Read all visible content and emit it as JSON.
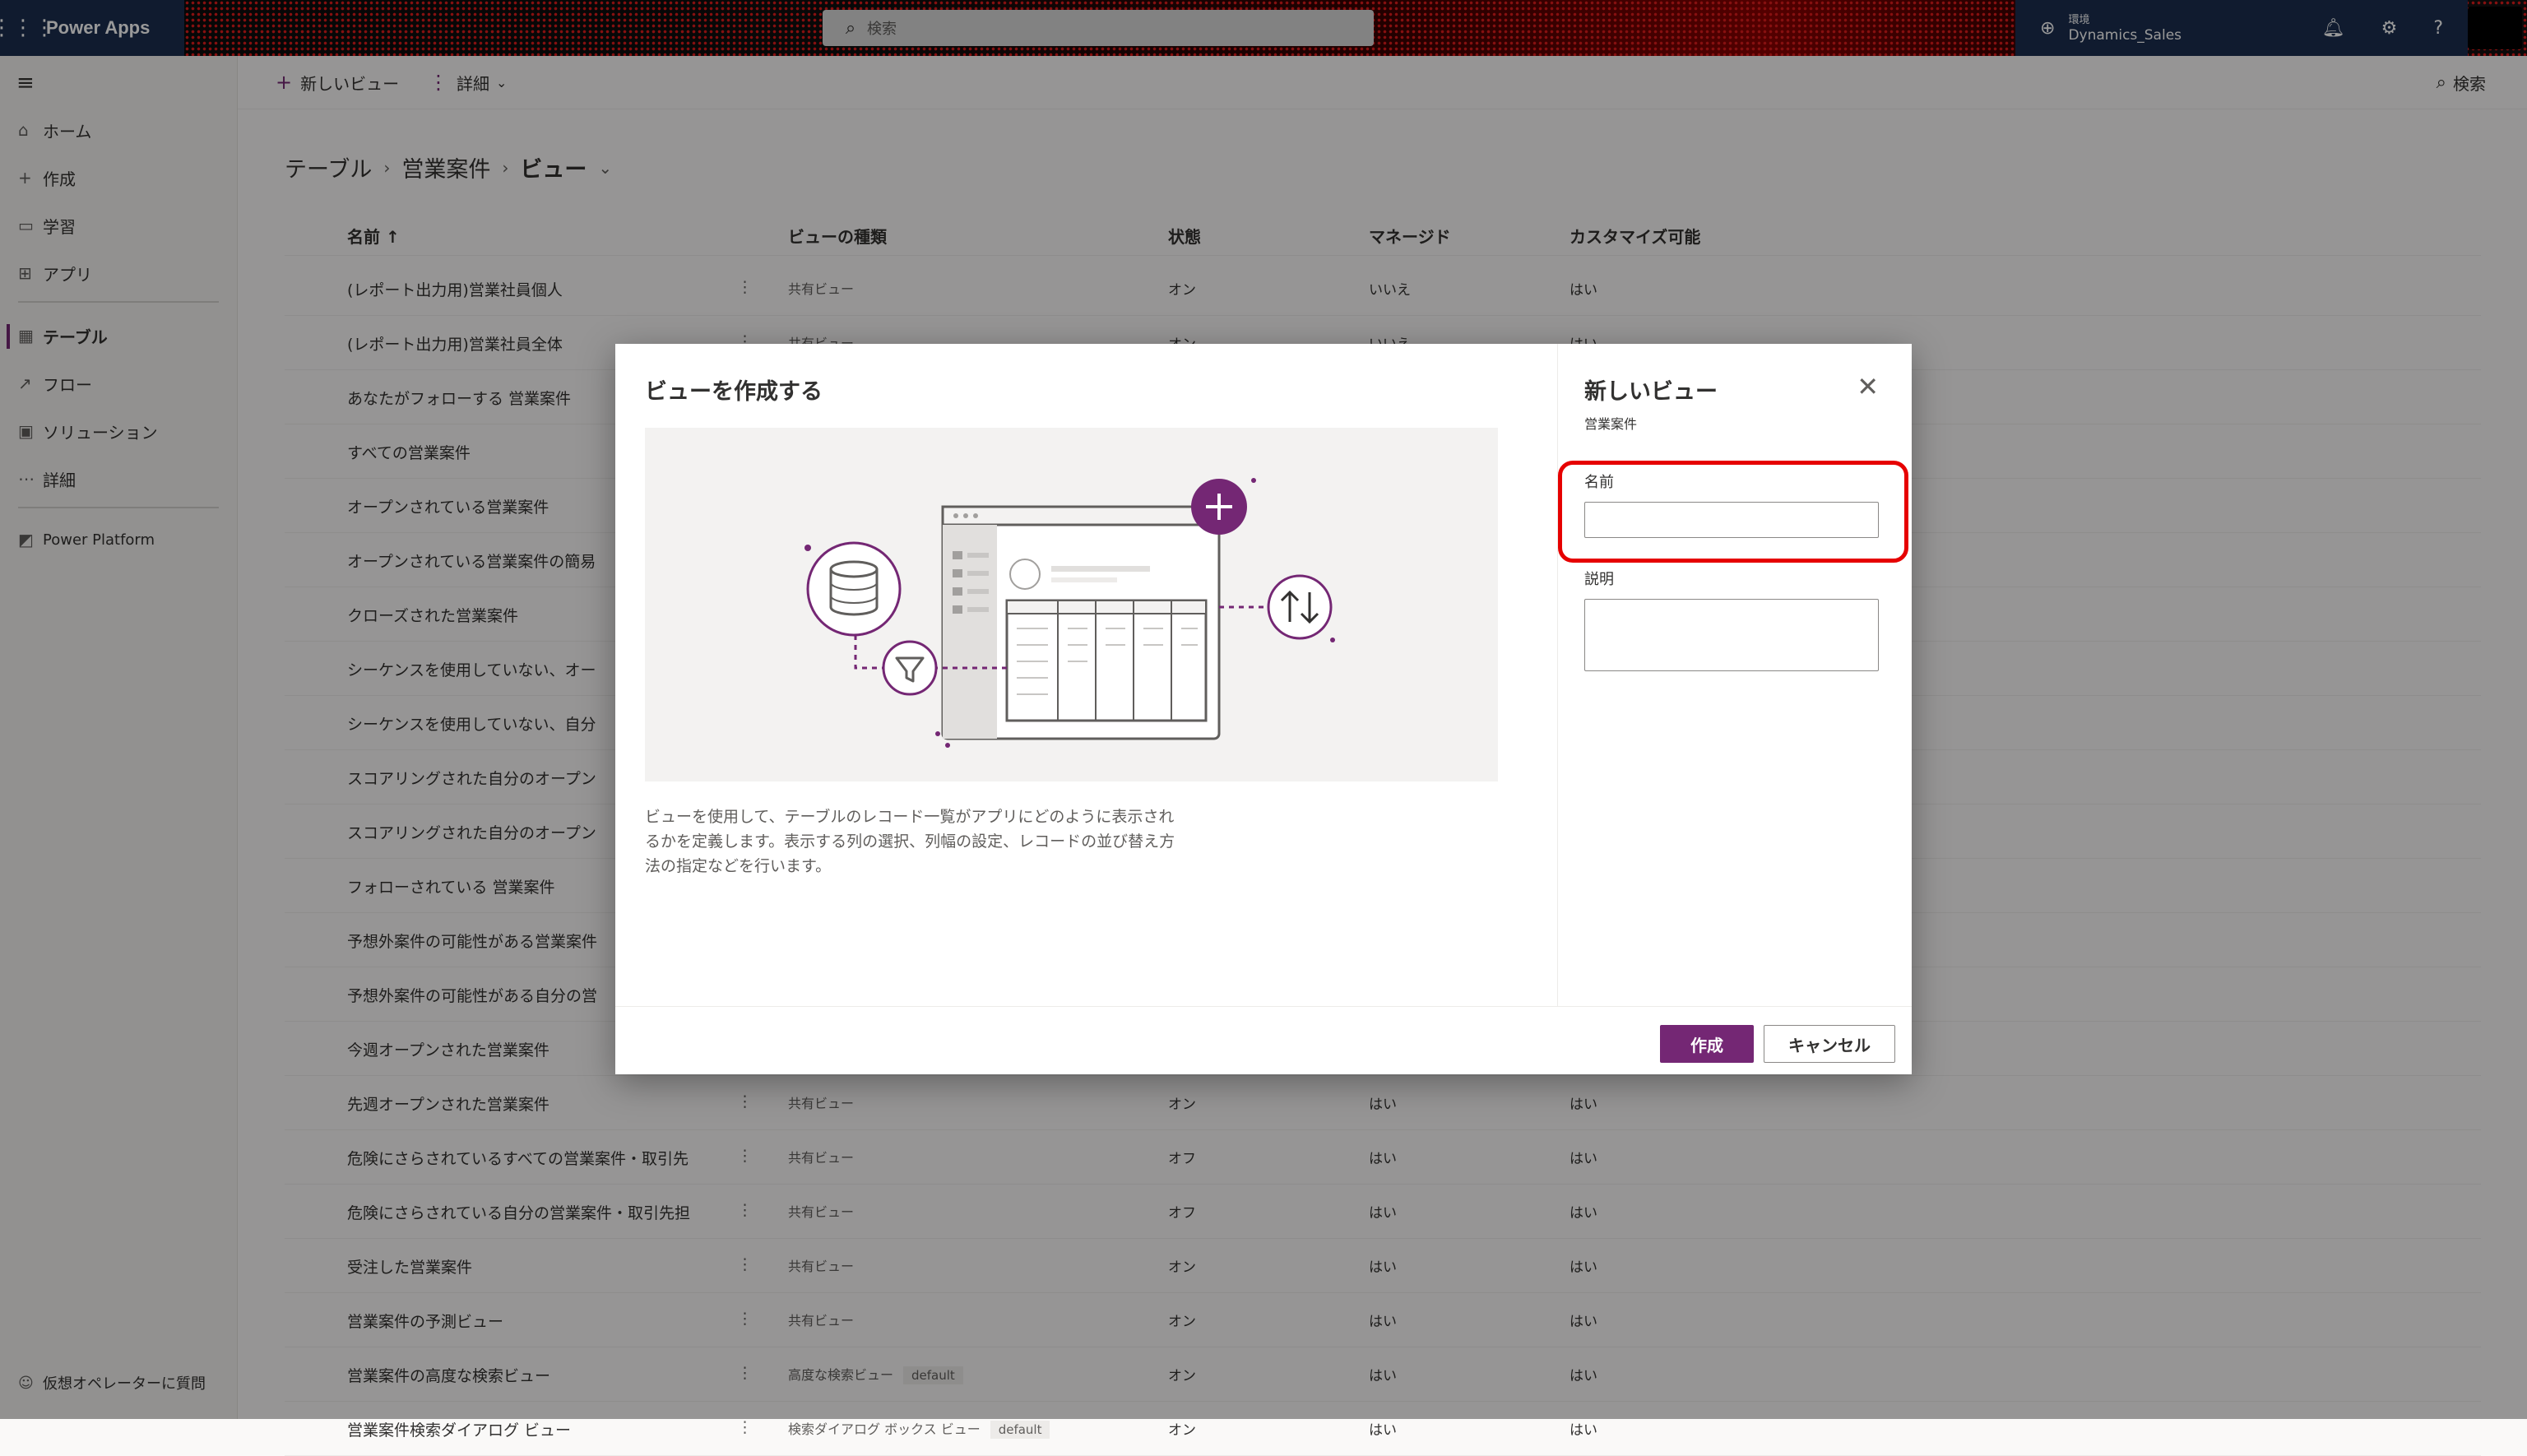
{
  "app": {
    "name": "Power Apps",
    "search_placeholder": "検索",
    "env_label": "環境",
    "env_name": "Dynamics_Sales"
  },
  "nav": {
    "items": [
      {
        "label": "ホーム",
        "icon": "home-icon"
      },
      {
        "label": "作成",
        "icon": "plus-icon"
      },
      {
        "label": "学習",
        "icon": "book-icon"
      },
      {
        "label": "アプリ",
        "icon": "apps-icon"
      },
      {
        "label": "テーブル",
        "icon": "table-icon"
      },
      {
        "label": "フロー",
        "icon": "flow-icon"
      },
      {
        "label": "ソリューション",
        "icon": "solution-icon"
      },
      {
        "label": "詳細",
        "icon": "more-icon"
      },
      {
        "label": "Power Platform",
        "icon": "power-platform-icon"
      }
    ],
    "active": "テーブル",
    "bottom_label": "仮想オペレーターに質問"
  },
  "commandbar": {
    "new_view": "新しいビュー",
    "details": "詳細",
    "search": "検索"
  },
  "breadcrumb": {
    "root": "テーブル",
    "table": "営業案件",
    "current": "ビュー"
  },
  "table": {
    "columns": [
      "名前 ↑",
      "ビューの種類",
      "状態",
      "マネージド",
      "カスタマイズ可能"
    ],
    "rows": [
      {
        "name": "(レポート出力用)営業社員個人",
        "type": "共有ビュー",
        "state": "オン",
        "managed": "いいえ",
        "customizable": "はい"
      },
      {
        "name": "(レポート出力用)営業社員全体",
        "type": "共有ビュー",
        "state": "オン",
        "managed": "いいえ",
        "customizable": "はい"
      },
      {
        "name": "あなたがフォローする 営業案件",
        "type": "",
        "state": "",
        "managed": "",
        "customizable": ""
      },
      {
        "name": "すべての営業案件",
        "type": "",
        "state": "",
        "managed": "",
        "customizable": ""
      },
      {
        "name": "オープンされている営業案件",
        "type": "",
        "state": "",
        "managed": "",
        "customizable": ""
      },
      {
        "name": "オープンされている営業案件の簡易",
        "type": "",
        "state": "",
        "managed": "",
        "customizable": ""
      },
      {
        "name": "クローズされた営業案件",
        "type": "",
        "state": "",
        "managed": "",
        "customizable": ""
      },
      {
        "name": "シーケンスを使用していない、オー",
        "type": "",
        "state": "",
        "managed": "",
        "customizable": ""
      },
      {
        "name": "シーケンスを使用していない、自分",
        "type": "",
        "state": "",
        "managed": "",
        "customizable": ""
      },
      {
        "name": "スコアリングされた自分のオープン",
        "type": "",
        "state": "",
        "managed": "",
        "customizable": ""
      },
      {
        "name": "スコアリングされた自分のオープン",
        "type": "",
        "state": "",
        "managed": "",
        "customizable": ""
      },
      {
        "name": "フォローされている 営業案件",
        "type": "",
        "state": "",
        "managed": "",
        "customizable": ""
      },
      {
        "name": "予想外案件の可能性がある営業案件",
        "type": "",
        "state": "",
        "managed": "",
        "customizable": ""
      },
      {
        "name": "予想外案件の可能性がある自分の営",
        "type": "",
        "state": "",
        "managed": "",
        "customizable": ""
      },
      {
        "name": "今週オープンされた営業案件",
        "type": "",
        "state": "",
        "managed": "",
        "customizable": ""
      },
      {
        "name": "先週オープンされた営業案件",
        "type": "共有ビュー",
        "state": "オン",
        "managed": "はい",
        "customizable": "はい"
      },
      {
        "name": "危険にさらされているすべての営業案件・取引先",
        "type": "共有ビュー",
        "state": "オフ",
        "managed": "はい",
        "customizable": "はい"
      },
      {
        "name": "危険にさらされている自分の営業案件・取引先担",
        "type": "共有ビュー",
        "state": "オフ",
        "managed": "はい",
        "customizable": "はい"
      },
      {
        "name": "受注した営業案件",
        "type": "共有ビュー",
        "state": "オン",
        "managed": "はい",
        "customizable": "はい"
      },
      {
        "name": "営業案件の予測ビュー",
        "type": "共有ビュー",
        "state": "オン",
        "managed": "はい",
        "customizable": "はい"
      },
      {
        "name": "営業案件の高度な検索ビュー",
        "type": "高度な検索ビュー",
        "badge": "default",
        "state": "オン",
        "managed": "はい",
        "customizable": "はい"
      },
      {
        "name": "営業案件検索ダイアログ ビュー",
        "type": "検索ダイアログ ボックス ビュー",
        "badge": "default",
        "state": "オン",
        "managed": "はい",
        "customizable": "はい"
      }
    ]
  },
  "dialog": {
    "title": "ビューを作成する",
    "description": "ビューを使用して、テーブルのレコード一覧がアプリにどのように表示されるかを定義します。表示する列の選択、列幅の設定、レコードの並び替え方法の指定などを行います。",
    "pane_title": "新しいビュー",
    "pane_subtitle": "営業案件",
    "name_label": "名前",
    "name_value": "",
    "desc_label": "説明",
    "desc_value": "",
    "create_button": "作成",
    "cancel_button": "キャンセル"
  },
  "colors": {
    "accent": "#742774",
    "brand_bar": "#1b2e4f",
    "highlight": "#e60000"
  }
}
